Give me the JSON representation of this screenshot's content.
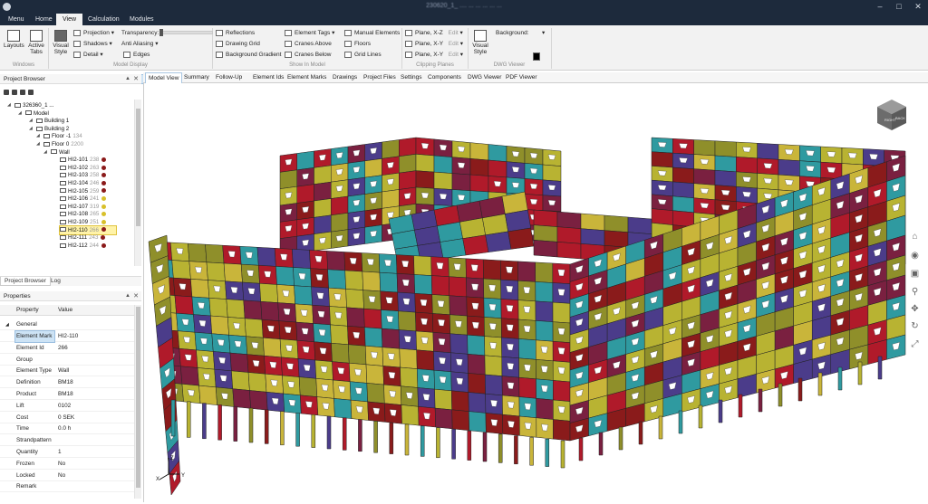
{
  "window": {
    "title": "230620_1_ .... ... ... ... ... ..."
  },
  "menu": {
    "items": [
      "Menu",
      "Home",
      "View",
      "Calculation",
      "Modules"
    ],
    "active": "View"
  },
  "ribbon": {
    "windows": {
      "layouts": "Layouts",
      "active_tabs": "Active Tabs",
      "group": "Windows"
    },
    "model_display": {
      "visual_style": "Visual Style",
      "projection": "Projection",
      "shadows": "Shadows",
      "detail": "Detail",
      "transparency": "Transparency:",
      "anti_aliasing": "Anti Aliasing",
      "edges": "Edges",
      "group": "Model Display"
    },
    "show_in_model": {
      "reflections": "Reflections",
      "drawing_grid": "Drawing Grid",
      "background_gradient": "Background Gradient",
      "element_tags": "Element Tags",
      "cranes_above": "Cranes Above",
      "cranes_below": "Cranes Below",
      "manual_elements": "Manual Elements",
      "floors": "Floors",
      "grid_lines": "Grid Lines",
      "group": "Show In Model"
    },
    "clipping_planes": {
      "planes": [
        {
          "label": "Plane, X-Z",
          "edit": "Edit"
        },
        {
          "label": "Plane, X-Y",
          "edit": "Edit"
        },
        {
          "label": "Plane, X-Y",
          "edit": "Edit"
        }
      ],
      "group": "Clipping Planes"
    },
    "dwg_viewer": {
      "visual_style": "Visual Style",
      "background": "Background:",
      "background_color": "#000000",
      "group": "DWG Viewer"
    }
  },
  "project_browser": {
    "title": "Project Browser",
    "tree": [
      {
        "label": "326360_1 ...",
        "count": "",
        "level": 0
      },
      {
        "label": "Model",
        "count": "",
        "level": 1
      },
      {
        "label": "Building 1",
        "count": "",
        "level": 2
      },
      {
        "label": "Building 2",
        "count": "",
        "level": 2
      },
      {
        "label": "Floor -1",
        "count": "134",
        "level": 3
      },
      {
        "label": "Floor 0",
        "count": "2200",
        "level": 3
      },
      {
        "label": "Wall",
        "count": "",
        "level": 4
      }
    ],
    "elements": [
      {
        "label": "HI2-101",
        "count": "238",
        "dot": "#8b1a1a"
      },
      {
        "label": "HI2-102",
        "count": "263",
        "dot": "#8b1a1a"
      },
      {
        "label": "HI2-103",
        "count": "258",
        "dot": "#8b1a1a"
      },
      {
        "label": "HI2-104",
        "count": "246",
        "dot": "#8b1a1a"
      },
      {
        "label": "HI2-105",
        "count": "259",
        "dot": "#8b1a1a"
      },
      {
        "label": "HI2-106",
        "count": "241",
        "dot": "#d8c02a"
      },
      {
        "label": "HI2-107",
        "count": "319",
        "dot": "#d8c02a"
      },
      {
        "label": "HI2-108",
        "count": "265",
        "dot": "#d8c02a"
      },
      {
        "label": "HI2-109",
        "count": "251",
        "dot": "#d8c02a"
      },
      {
        "label": "HI2-110",
        "count": "266",
        "dot": "#8b1a1a",
        "selected": true
      },
      {
        "label": "HI2-111",
        "count": "243",
        "dot": "#8b1a1a"
      },
      {
        "label": "HI2-112",
        "count": "244",
        "dot": "#8b1a1a"
      }
    ]
  },
  "bottom_tabs": [
    "Project Browser",
    "Log"
  ],
  "properties": {
    "title": "Properties",
    "col_property": "Property",
    "col_value": "Value",
    "group": "General",
    "rows": [
      {
        "k": "Element Mark",
        "v": "HI2-110",
        "selected": true
      },
      {
        "k": "Element Id",
        "v": "266"
      },
      {
        "k": "Group",
        "v": ""
      },
      {
        "k": "Element Type",
        "v": "Wall"
      },
      {
        "k": "Definition",
        "v": "BM18"
      },
      {
        "k": "Product",
        "v": "BM18"
      },
      {
        "k": "Lift",
        "v": "0102"
      },
      {
        "k": "Cost",
        "v": "0 SEK"
      },
      {
        "k": "Time",
        "v": "0.0 h"
      },
      {
        "k": "Strandpattern",
        "v": ""
      },
      {
        "k": "Quantity",
        "v": "1"
      },
      {
        "k": "Frozen",
        "v": "No"
      },
      {
        "k": "Locked",
        "v": "No"
      },
      {
        "k": "Remark",
        "v": ""
      }
    ]
  },
  "view_tabs": [
    "Model View",
    "Summary",
    "Follow-Up",
    "Element Ids",
    "Element Marks",
    "Drawings",
    "Project Files",
    "Settings",
    "Components",
    "DWG Viewer",
    "PDF Viewer"
  ],
  "active_view_tab": "Model View",
  "viewcube": {
    "left_face": "RIGHT",
    "front_face": "BACK"
  },
  "axis_labels": {
    "z": "Z",
    "x": "X",
    "y": "Y"
  },
  "palette": {
    "teal": "#2f9aa0",
    "yellow": "#b8b332",
    "purple": "#4b3c8a",
    "red": "#b01a2a",
    "maroon": "#7a2040",
    "olive": "#8f8f2a",
    "darkred": "#8a1b1b",
    "mustard": "#c9b53a"
  }
}
